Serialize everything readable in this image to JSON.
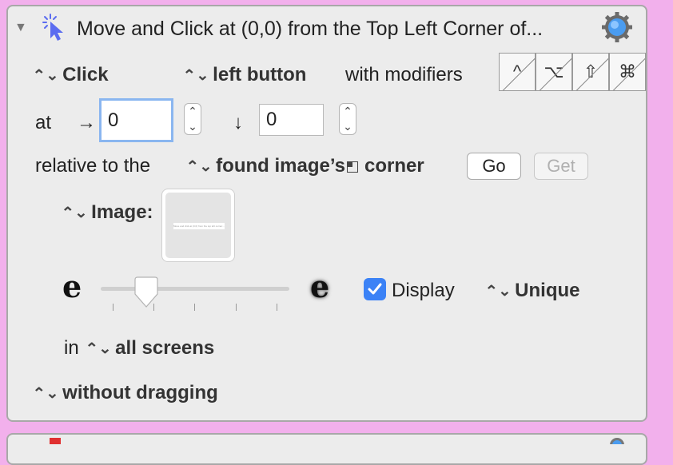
{
  "header": {
    "title": "Move and Click at (0,0) from the Top Left Corner of..."
  },
  "action_row": {
    "action": "Click",
    "button": "left button",
    "modifiers_label": "with modifiers",
    "modifiers": [
      {
        "symbol": "^",
        "name": "control"
      },
      {
        "symbol": "⌥",
        "name": "option"
      },
      {
        "symbol": "⇧",
        "name": "shift"
      },
      {
        "symbol": "⌘",
        "name": "command"
      }
    ]
  },
  "position": {
    "at_label": "at",
    "x_arrow": "→",
    "x_value": "0",
    "y_arrow": "↓",
    "y_value": "0"
  },
  "relative": {
    "label": "relative to the",
    "target": "found image’s",
    "corner_label": "corner",
    "go_label": "Go",
    "get_label": "Get"
  },
  "image": {
    "label": "Image:",
    "thumb_caption": "Move and click at (0,0) from the top left corner..."
  },
  "fuzziness": {
    "left_glyph": "e",
    "right_glyph": "e",
    "slider_value": 0.2,
    "display_label": "Display",
    "display_checked": true,
    "unique_label": "Unique"
  },
  "screens": {
    "in_label": "in",
    "value": "all screens"
  },
  "dragging": {
    "value": "without dragging"
  },
  "colors": {
    "background": "#f2b0ec",
    "panel": "#ececec",
    "accent": "#3b82f6"
  }
}
